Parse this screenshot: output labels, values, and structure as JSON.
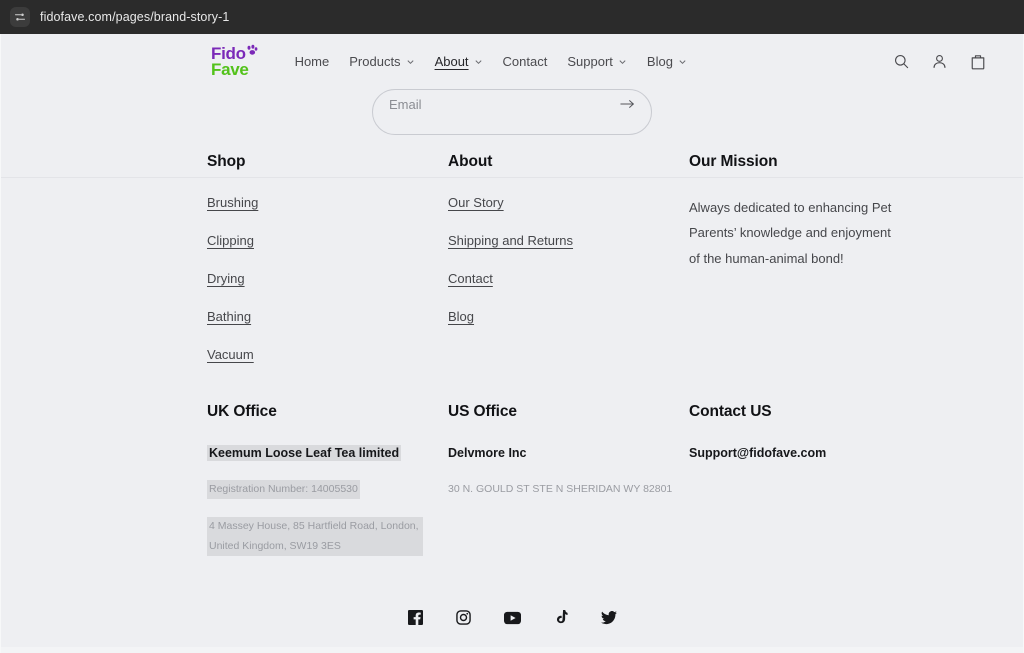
{
  "browser": {
    "url": "fidofave.com/pages/brand-story-1",
    "left_icon": "sliders-icon"
  },
  "header": {
    "logo": {
      "line1": "Fido",
      "line2": "Fave",
      "line1_color": "#7b29b8",
      "line2_color": "#53c21b"
    },
    "nav": [
      {
        "label": "Home",
        "has_dropdown": false,
        "active": false
      },
      {
        "label": "Products",
        "has_dropdown": true,
        "active": false
      },
      {
        "label": "About",
        "has_dropdown": true,
        "active": true
      },
      {
        "label": "Contact",
        "has_dropdown": false,
        "active": false
      },
      {
        "label": "Support",
        "has_dropdown": true,
        "active": false
      },
      {
        "label": "Blog",
        "has_dropdown": true,
        "active": false
      }
    ],
    "icons": [
      {
        "name": "search-icon",
        "label": "Search"
      },
      {
        "name": "account-icon",
        "label": "Log in"
      },
      {
        "name": "cart-icon",
        "label": "Cart"
      }
    ]
  },
  "newsletter": {
    "placeholder": "Email",
    "submit_icon": "arrow-right-icon"
  },
  "footer": {
    "columns": [
      {
        "title": "Shop",
        "links": [
          "Brushing",
          "Clipping",
          "Drying",
          "Bathing",
          "Vacuum"
        ]
      },
      {
        "title": "About",
        "links": [
          "Our Story",
          "Shipping and Returns",
          "Contact",
          "Blog"
        ]
      },
      {
        "title": "Our Mission",
        "text": "Always dedicated to enhancing Pet Parents’ knowledge and enjoyment of the human-animal bond!"
      }
    ],
    "offices": [
      {
        "title": "UK Office",
        "company": "Keemum Loose Leaf Tea limited",
        "registration": "Registration Number: 14005530",
        "address": "4 Massey House, 85 Hartfield Road, London, United Kingdom, SW19 3ES",
        "highlighted": true
      },
      {
        "title": "US Office",
        "company": "Delvmore Inc",
        "address": "30 N. GOULD ST STE N SHERIDAN WY 82801",
        "highlighted": false
      },
      {
        "title": "Contact US",
        "company": "Support@fidofave.com",
        "highlighted": false
      }
    ],
    "socials": [
      {
        "name": "facebook-icon",
        "label": "Facebook"
      },
      {
        "name": "instagram-icon",
        "label": "Instagram"
      },
      {
        "name": "youtube-icon",
        "label": "YouTube"
      },
      {
        "name": "tiktok-icon",
        "label": "TikTok"
      },
      {
        "name": "twitter-icon",
        "label": "Twitter"
      }
    ]
  },
  "colors": {
    "page_background": "#eeeff2",
    "urlbar_background": "#2b2b2b",
    "text_primary": "#16171a",
    "text_secondary": "#46474b",
    "text_muted": "#9a9ca2",
    "highlight": "#d9dadd"
  }
}
